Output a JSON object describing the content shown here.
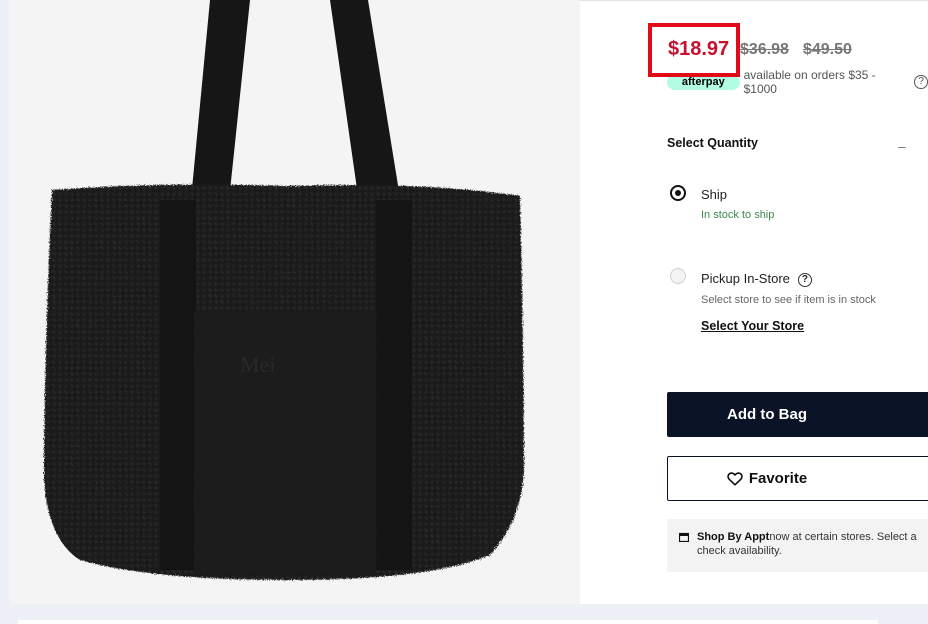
{
  "pricing": {
    "current_price": "$18.97",
    "was_price_1": "$36.98",
    "was_price_2": "$49.50",
    "highlight_color": "#e20a17"
  },
  "afterpay": {
    "badge": "afterpay",
    "text": "available on orders $35 - $1000",
    "help_icon": "help-circle-icon"
  },
  "quantity": {
    "label": "Select Quantity",
    "toggle_symbol": "–"
  },
  "fulfillment": {
    "ship": {
      "label": "Ship",
      "status": "In stock to ship",
      "selected": true
    },
    "pickup": {
      "label": "Pickup In-Store",
      "status": "Select store to see if item is in stock",
      "link": "Select Your Store",
      "selected": false
    }
  },
  "actions": {
    "add_to_bag": "Add to Bag",
    "favorite": "Favorite"
  },
  "appointment": {
    "title": "Shop By Appt",
    "text_part1": " now at certain stores. Select a",
    "text_part2": "check availability."
  },
  "product": {
    "image_desc_icon": "tote-bag-image",
    "bag_color": "#1c1c1c"
  }
}
